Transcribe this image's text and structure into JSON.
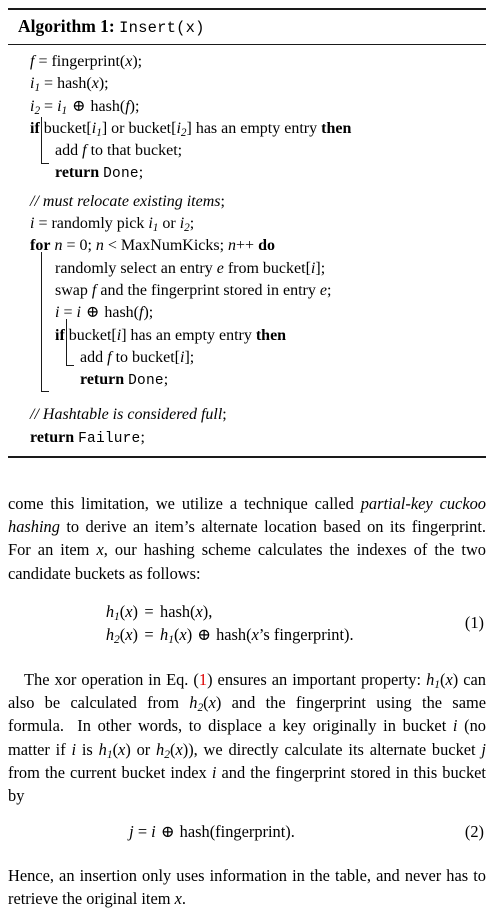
{
  "algorithm": {
    "caption_label": "Algorithm 1:",
    "caption_signature": "Insert(x)",
    "lines": [
      {
        "id": "l1",
        "level": 0,
        "text": "f = fingerprint(x);"
      },
      {
        "id": "l2",
        "level": 0,
        "text": "i1 = hash(x);"
      },
      {
        "id": "l3",
        "level": 0,
        "text": "i2 = i1 ⊕ hash(f);"
      },
      {
        "id": "l4",
        "level": 0,
        "text": "if bucket[i1] or bucket[i2] has an empty entry then"
      },
      {
        "id": "l5",
        "level": 1,
        "text": "add f to that bucket;"
      },
      {
        "id": "l6",
        "level": 1,
        "text": "return Done;"
      },
      {
        "id": "l7",
        "level": 0,
        "text": "// must relocate existing items;"
      },
      {
        "id": "l8",
        "level": 0,
        "text": "i = randomly pick i1 or i2;"
      },
      {
        "id": "l9",
        "level": 0,
        "text": "for n = 0; n < MaxNumKicks; n++ do"
      },
      {
        "id": "l10",
        "level": 1,
        "text": "randomly select an entry e from bucket[i];"
      },
      {
        "id": "l11",
        "level": 1,
        "text": "swap f and the fingerprint stored in entry e;"
      },
      {
        "id": "l12",
        "level": 1,
        "text": "i = i ⊕ hash(f);"
      },
      {
        "id": "l13",
        "level": 1,
        "text": "if bucket[i] has an empty entry then"
      },
      {
        "id": "l14",
        "level": 2,
        "text": "add f to bucket[i];"
      },
      {
        "id": "l15",
        "level": 2,
        "text": "return Done;"
      },
      {
        "id": "l16",
        "level": 0,
        "text": "// Hashtable is considered full;"
      },
      {
        "id": "l17",
        "level": 0,
        "text": "return Failure;"
      }
    ],
    "keywords": [
      "if",
      "then",
      "return",
      "for",
      "do"
    ],
    "monospace_literals": [
      "Insert(x)",
      "Done",
      "Failure"
    ]
  },
  "prose": {
    "para1": "come this limitation, we utilize a technique called partial-key cuckoo hashing to derive an item's alternate location based on its fingerprint. For an item x, our hashing scheme calculates the indexes of the two candidate buckets as follows:",
    "para1_emph": [
      "partial-key cuckoo hashing",
      "x"
    ],
    "para2": "The xor operation in Eq. (1) ensures an important property: h1(x) can also be calculated from h2(x) and the fingerprint using the same formula. In other words, to displace a key originally in bucket i (no matter if i is h1(x) or h2(x)), we directly calculate its alternate bucket j from the current bucket index i and the fingerprint stored in this bucket by",
    "para2_ref": "1",
    "para3": "Hence, an insertion only uses information in the table, and never has to retrieve the original item x."
  },
  "equations": [
    {
      "id": "eq1",
      "number": "(1)",
      "rows": [
        {
          "lhs": "h1(x)",
          "rel": "=",
          "rhs": "hash(x),"
        },
        {
          "lhs": "h2(x)",
          "rel": "=",
          "rhs": "h1(x) ⊕ hash(x's fingerprint)."
        }
      ]
    },
    {
      "id": "eq2",
      "number": "(2)",
      "rows": [
        {
          "lhs": "",
          "rel": "",
          "rhs": "j = i ⊕ hash(fingerprint)."
        }
      ]
    }
  ],
  "colors": {
    "text": "#000000",
    "rule": "#1a1a1a",
    "crossref_link": "#dd0000",
    "background": "#ffffff"
  }
}
